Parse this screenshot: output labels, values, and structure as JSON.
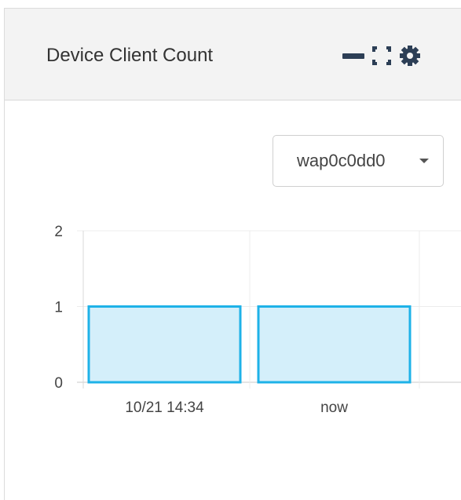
{
  "widget": {
    "title": "Device Client Count",
    "icons": [
      "minus-icon",
      "expand-icon",
      "gear-icon"
    ]
  },
  "device_selector": {
    "selected": "wap0c0dd0"
  },
  "chart_data": {
    "type": "bar",
    "categories": [
      "10/21 14:34",
      "now"
    ],
    "values": [
      1,
      1
    ],
    "ylim": [
      0,
      2
    ],
    "yticks": [
      "0",
      "1",
      "2"
    ],
    "grid": true,
    "bar_fill": "#d4effa",
    "bar_stroke": "#1eb2e8"
  }
}
